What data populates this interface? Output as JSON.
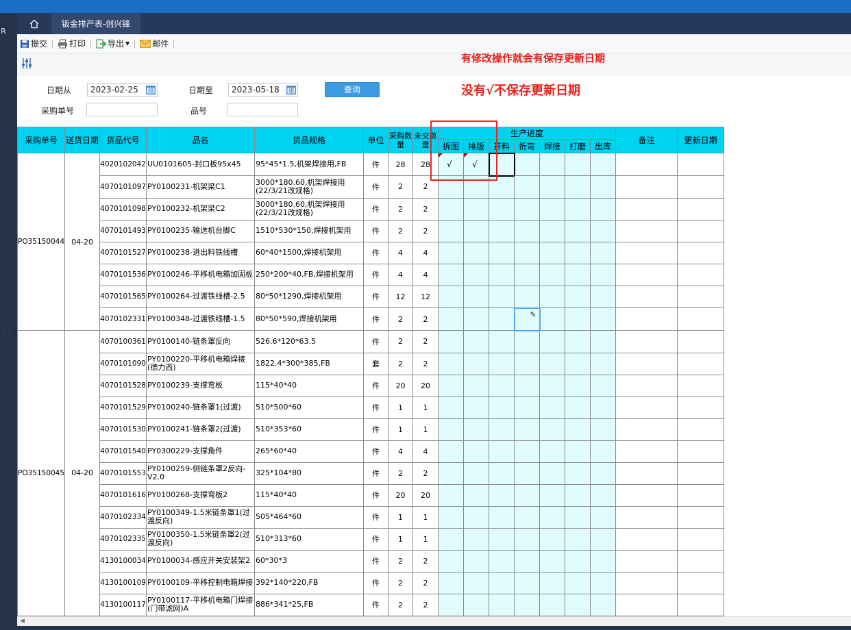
{
  "app": {
    "left_letter": "R"
  },
  "tabs": {
    "active": "钣金排产表-创兴锋"
  },
  "toolbar": {
    "submit": "提交",
    "print": "打印",
    "export": "导出",
    "mail": "邮件"
  },
  "notes": {
    "line1": "有修改操作就会有保存更新日期",
    "line2": "没有√不保存更新日期"
  },
  "filters": {
    "date_from_label": "日期从",
    "date_from": "2023-02-25",
    "date_to_label": "日期至",
    "date_to": "2023-05-18",
    "query_label": "查询",
    "po_label": "采购单号",
    "po_value": "",
    "part_label": "品号",
    "part_value": ""
  },
  "columns": {
    "po": "采购单号",
    "ship_date": "送货日期",
    "code": "货品代号",
    "name": "品名",
    "spec": "货品规格",
    "unit": "单位",
    "qty": "采购数量",
    "remain": "未交数量",
    "progress": "生产进度",
    "steps": [
      "拆图",
      "排版",
      "开料",
      "折弯",
      "焊接",
      "打磨",
      "出库"
    ],
    "remark": "备注",
    "updated": "更新日期"
  },
  "groups": [
    {
      "po": "PO35150044",
      "ship": "04-20",
      "rows": [
        {
          "code": "4020102042",
          "name": "UU0101605-封口板95x45",
          "spec": "95*45*1.5,机架焊接用,FB",
          "unit": "件",
          "qty": "28",
          "remain": "28",
          "checks": [
            "√",
            "√",
            "",
            "",
            "",
            "",
            ""
          ]
        },
        {
          "code": "4070101097",
          "name": "PY0100231-机架梁C1",
          "spec": "3000*180.60,机架焊接用(22/3/21改规格)",
          "unit": "件",
          "qty": "2",
          "remain": "2",
          "checks": [
            "",
            "",
            "",
            "",
            "",
            "",
            ""
          ]
        },
        {
          "code": "4070101098",
          "name": "PY0100232-机架梁C2",
          "spec": "3000*180.60,机架焊接用(22/3/21改规格)",
          "unit": "件",
          "qty": "2",
          "remain": "2",
          "checks": [
            "",
            "",
            "",
            "",
            "",
            "",
            ""
          ]
        },
        {
          "code": "4070101493",
          "name": "PY0100235-输送机台脚C",
          "spec": "1510*530*150,焊接机架用",
          "unit": "件",
          "qty": "2",
          "remain": "2",
          "checks": [
            "",
            "",
            "",
            "",
            "",
            "",
            ""
          ]
        },
        {
          "code": "4070101527",
          "name": "PY0100238-进出料铁线槽",
          "spec": "60*40*1500,焊接机架用",
          "unit": "件",
          "qty": "4",
          "remain": "4",
          "checks": [
            "",
            "",
            "",
            "",
            "",
            "",
            ""
          ]
        },
        {
          "code": "4070101536",
          "name": "PY0100246-平移机电箱加固板",
          "spec": "250*200*40,FB,焊接机架用",
          "unit": "件",
          "qty": "4",
          "remain": "4",
          "checks": [
            "",
            "",
            "",
            "",
            "",
            "",
            ""
          ]
        },
        {
          "code": "4070101565",
          "name": "PY0100264-过渡铁线槽-2.5",
          "spec": "80*50*1290,焊接机架用",
          "unit": "件",
          "qty": "12",
          "remain": "12",
          "checks": [
            "",
            "",
            "",
            "",
            "",
            "",
            ""
          ]
        },
        {
          "code": "4070102331",
          "name": "PY0100348-过渡铁线槽-1.5",
          "spec": "80*50*590,焊接机架用",
          "unit": "件",
          "qty": "2",
          "remain": "2",
          "checks": [
            "",
            "",
            "",
            "",
            "",
            "",
            ""
          ]
        }
      ]
    },
    {
      "po": "PO35150045",
      "ship": "04-20",
      "rows": [
        {
          "code": "4070100361",
          "name": "PY0100140-链条罩反向",
          "spec": "526.6*120*63.5",
          "unit": "件",
          "qty": "2",
          "remain": "2",
          "checks": [
            "",
            "",
            "",
            "",
            "",
            "",
            ""
          ]
        },
        {
          "code": "4070101090",
          "name": "PY0100220-平移机电箱焊接(德力西)",
          "spec": "1822.4*300*385,FB",
          "unit": "套",
          "qty": "2",
          "remain": "2",
          "checks": [
            "",
            "",
            "",
            "",
            "",
            "",
            ""
          ]
        },
        {
          "code": "4070101528",
          "name": "PY0100239-支撑弯板",
          "spec": "115*40*40",
          "unit": "件",
          "qty": "20",
          "remain": "20",
          "checks": [
            "",
            "",
            "",
            "",
            "",
            "",
            ""
          ]
        },
        {
          "code": "4070101529",
          "name": "PY0100240-链条罩1(过渡)",
          "spec": "510*500*60",
          "unit": "件",
          "qty": "1",
          "remain": "1",
          "checks": [
            "",
            "",
            "",
            "",
            "",
            "",
            ""
          ]
        },
        {
          "code": "4070101530",
          "name": "PY0100241-链条罩2(过渡)",
          "spec": "510*353*60",
          "unit": "件",
          "qty": "1",
          "remain": "1",
          "checks": [
            "",
            "",
            "",
            "",
            "",
            "",
            ""
          ]
        },
        {
          "code": "4070101540",
          "name": "PY0300229-支撑角件",
          "spec": "265*60*40",
          "unit": "件",
          "qty": "4",
          "remain": "4",
          "checks": [
            "",
            "",
            "",
            "",
            "",
            "",
            ""
          ]
        },
        {
          "code": "4070101553",
          "name": "PY0100259-侧链条罩2反向-V2.0",
          "spec": "325*104*80",
          "unit": "件",
          "qty": "2",
          "remain": "2",
          "checks": [
            "",
            "",
            "",
            "",
            "",
            "",
            ""
          ]
        },
        {
          "code": "4070101616",
          "name": "PY0100268-支撑弯板2",
          "spec": "115*40*40",
          "unit": "件",
          "qty": "20",
          "remain": "20",
          "checks": [
            "",
            "",
            "",
            "",
            "",
            "",
            ""
          ]
        },
        {
          "code": "4070102334",
          "name": "PY0100349-1.5米链条罩1(过渡反向)",
          "spec": "505*464*60",
          "unit": "件",
          "qty": "1",
          "remain": "1",
          "checks": [
            "",
            "",
            "",
            "",
            "",
            "",
            ""
          ]
        },
        {
          "code": "4070102335",
          "name": "PY0100350-1.5米链条罩2(过渡反向)",
          "spec": "510*313*60",
          "unit": "件",
          "qty": "1",
          "remain": "1",
          "checks": [
            "",
            "",
            "",
            "",
            "",
            "",
            ""
          ]
        },
        {
          "code": "4130100034",
          "name": "PY0100034-感应开关安装架2",
          "spec": "60*30*3",
          "unit": "件",
          "qty": "2",
          "remain": "2",
          "checks": [
            "",
            "",
            "",
            "",
            "",
            "",
            ""
          ]
        },
        {
          "code": "4130100109",
          "name": "PY0100109-平移控制电箱焊接",
          "spec": "392*140*220,FB",
          "unit": "件",
          "qty": "2",
          "remain": "2",
          "checks": [
            "",
            "",
            "",
            "",
            "",
            "",
            ""
          ]
        },
        {
          "code": "4130100117",
          "name": "PY0100117-平移机电箱门焊接(门带滤网)A",
          "spec": "886*341*25,FB",
          "unit": "件",
          "qty": "2",
          "remain": "2",
          "checks": [
            "",
            "",
            "",
            "",
            "",
            "",
            ""
          ]
        }
      ]
    }
  ]
}
